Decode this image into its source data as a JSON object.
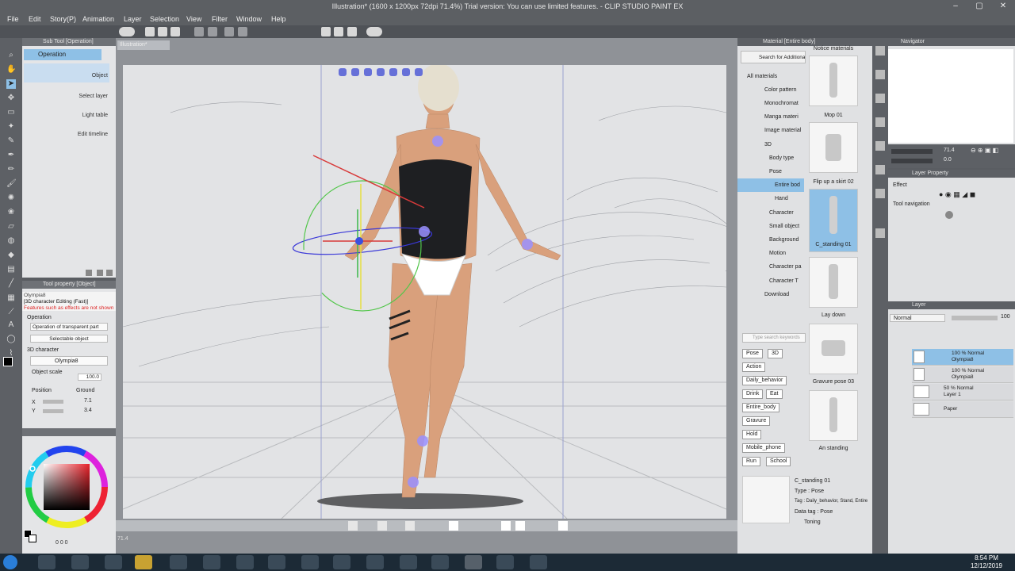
{
  "window": {
    "title": "Illustration* (1600 x 1200px 72dpi 71.4%)  Trial version: You can use limited features. - CLIP STUDIO PAINT EX",
    "controls": [
      "–",
      "▢",
      "✕"
    ]
  },
  "menu": [
    "File",
    "Edit",
    "Story(P)",
    "Animation",
    "Layer",
    "Selection",
    "View",
    "Filter",
    "Window",
    "Help"
  ],
  "subtool": {
    "title": "Sub Tool [Operation]",
    "active_tab": "Operation",
    "items": [
      "Object",
      "Select layer",
      "Light table",
      "Edit timeline"
    ]
  },
  "tool_property": {
    "title": "Tool property [Object]",
    "tag": "Olympia8",
    "mode": "[3D character Editing (Fast)]",
    "warning": "Features such as effects are not shown in the f",
    "operation_label": "Operation",
    "operation_value": "Operation of transparent part",
    "selectable_object": "Selectable object",
    "section": "3D character",
    "character": "Olympia8",
    "object_scale_label": "Object scale",
    "object_scale_value": "100.0",
    "position_label": "Position",
    "ground_label": "Ground",
    "x_label": "X",
    "x_value": "7.1",
    "y_label": "Y",
    "y_value": "3.4"
  },
  "color": {
    "readout": "0 0 0",
    "fg": "#000000",
    "bg": "#ffffff",
    "accent": "#e8222a"
  },
  "canvas": {
    "tab": "Illustration*",
    "zoom": "71.4"
  },
  "material": {
    "title": "Material [Entire body]",
    "search_placeholder": "Search for Additional m",
    "keyword_placeholder": "Type search keywords",
    "tree": [
      {
        "label": "All materials",
        "indent": 0
      },
      {
        "label": "Color pattern",
        "indent": 1
      },
      {
        "label": "Monochromat",
        "indent": 1
      },
      {
        "label": "Manga materi",
        "indent": 1
      },
      {
        "label": "Image material",
        "indent": 1
      },
      {
        "label": "3D",
        "indent": 1
      },
      {
        "label": "Body type",
        "indent": 2
      },
      {
        "label": "Pose",
        "indent": 2
      },
      {
        "label": "Entire bod",
        "indent": 3
      },
      {
        "label": "Hand",
        "indent": 3
      },
      {
        "label": "Character",
        "indent": 2
      },
      {
        "label": "Small object",
        "indent": 2
      },
      {
        "label": "Background",
        "indent": 2
      },
      {
        "label": "Motion",
        "indent": 2
      },
      {
        "label": "Character pa",
        "indent": 2
      },
      {
        "label": "Character T",
        "indent": 2
      },
      {
        "label": "Download",
        "indent": 1
      }
    ],
    "selected_tree_item": "Entire bod",
    "tiles": [
      "Notice materials",
      "Mop 01",
      "Flip up a skirt 02",
      "C_standing 01",
      "Lay down",
      "Gravure pose 03",
      "An standing"
    ],
    "selected_tile": "C_standing 01",
    "tags": [
      "Pose",
      "3D",
      "Action",
      "Daily_behavior",
      "Drink",
      "Eat",
      "Entire_body",
      "Gravure",
      "Hold",
      "Mobile_phone",
      "Run",
      "School"
    ],
    "detail": {
      "name": "C_standing 01",
      "type": "Type : Pose",
      "tag": "Tag : Daily_behavior, Stand, Entire",
      "data_tag": "Data tag : Pose",
      "toning": "Toning"
    }
  },
  "navigator": {
    "title": "Navigator",
    "zoom": "71.4",
    "rotate": "0.0"
  },
  "layer_property": {
    "title": "Layer Property",
    "effect": "Effect",
    "tool_navigation": "Tool navigation"
  },
  "layers": {
    "title": "Layer",
    "blend_mode": "Normal",
    "opacity": "100",
    "rows": [
      {
        "line1": "100 % Normal",
        "line2": "Olympia8",
        "selected": true
      },
      {
        "line1": "100 % Normal",
        "line2": "Olympia8",
        "selected": false
      },
      {
        "line1": "50 % Normal",
        "line2": "Layer 1",
        "selected": false
      },
      {
        "line1": "",
        "line2": "Paper",
        "selected": false
      }
    ]
  },
  "taskbar": {
    "time": "8:54 PM",
    "date": "12/12/2019"
  }
}
